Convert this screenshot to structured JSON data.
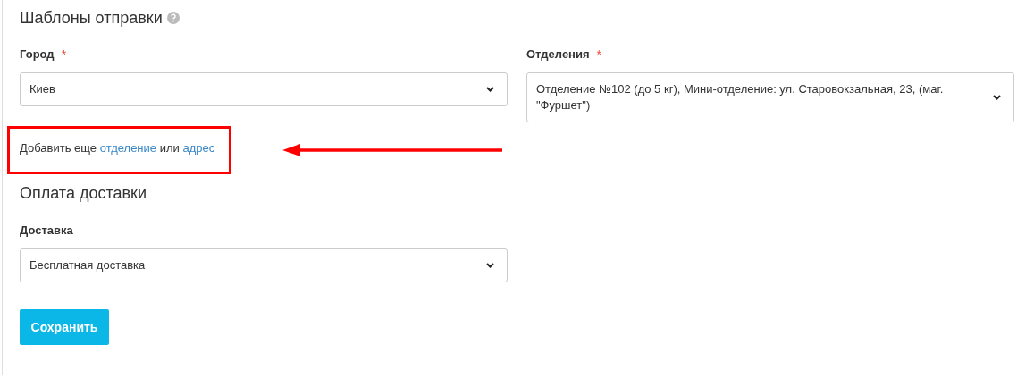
{
  "sections": [
    {
      "title": "Шаблоны отправки",
      "help": true,
      "fields": [
        {
          "label": "Город",
          "required_mark": "*",
          "value": "Киев"
        },
        {
          "label": "Отделения",
          "required_mark": "*",
          "value": "Отделение №102 (до 5 кг), Мини-отделение: ул. Старовокзальная, 23, (маг. \"Фуршет\")"
        }
      ],
      "add_line": [
        {
          "kind": "text",
          "text": "Добавить еще"
        },
        {
          "kind": "link",
          "text": "отделение"
        },
        {
          "kind": "text",
          "text": "или"
        },
        {
          "kind": "link",
          "text": "адрес"
        }
      ]
    },
    {
      "title": "Оплата доставки",
      "help": false,
      "fields": [
        {
          "label": "Доставка",
          "value": "Бесплатная доставка"
        }
      ]
    }
  ],
  "save_button": "Сохранить"
}
